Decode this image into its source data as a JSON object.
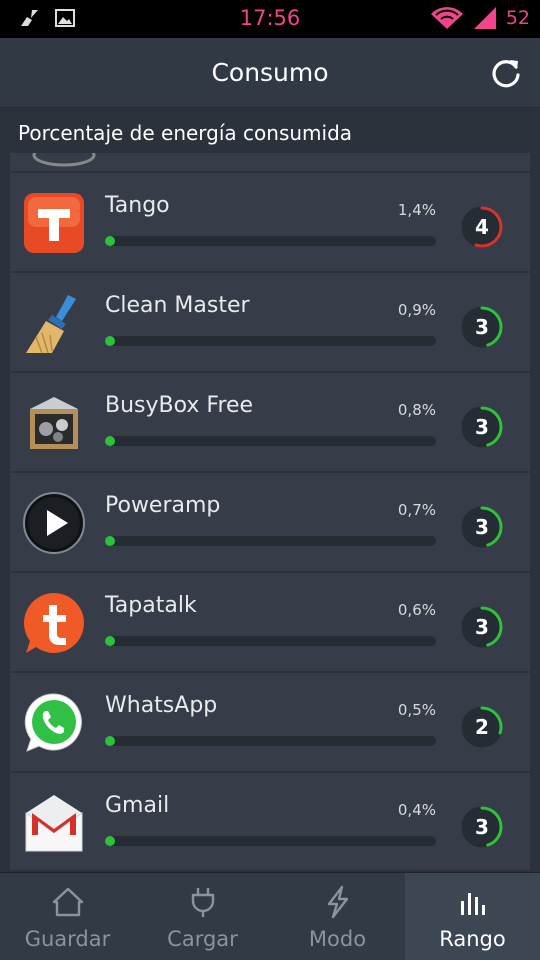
{
  "status_bar": {
    "time": "17:56",
    "battery": "52",
    "left_icons": [
      "broom-icon",
      "image-icon"
    ],
    "right_icons": [
      "wifi-icon",
      "signal-icon"
    ]
  },
  "header": {
    "title": "Consumo",
    "refresh_icon": "refresh-icon"
  },
  "section": {
    "title": "Porcentaje de energía consumida"
  },
  "apps": [
    {
      "name": "Tango",
      "percent": "1,4%",
      "rank": "4",
      "bar_fraction": 0.03,
      "rank_fraction": 0.55,
      "rank_color": "#d9342b",
      "icon": "tango-icon"
    },
    {
      "name": "Clean Master",
      "percent": "0,9%",
      "rank": "3",
      "bar_fraction": 0.03,
      "rank_fraction": 0.45,
      "rank_color": "#2cc23a",
      "icon": "broom-icon"
    },
    {
      "name": "BusyBox Free",
      "percent": "0,8%",
      "rank": "3",
      "bar_fraction": 0.03,
      "rank_fraction": 0.45,
      "rank_color": "#2cc23a",
      "icon": "busybox-icon"
    },
    {
      "name": "Poweramp",
      "percent": "0,7%",
      "rank": "3",
      "bar_fraction": 0.03,
      "rank_fraction": 0.45,
      "rank_color": "#2cc23a",
      "icon": "play-icon"
    },
    {
      "name": "Tapatalk",
      "percent": "0,6%",
      "rank": "3",
      "bar_fraction": 0.03,
      "rank_fraction": 0.45,
      "rank_color": "#2cc23a",
      "icon": "tapatalk-icon"
    },
    {
      "name": "WhatsApp",
      "percent": "0,5%",
      "rank": "2",
      "bar_fraction": 0.03,
      "rank_fraction": 0.3,
      "rank_color": "#2cc23a",
      "icon": "whatsapp-icon"
    },
    {
      "name": "Gmail",
      "percent": "0,4%",
      "rank": "3",
      "bar_fraction": 0.03,
      "rank_fraction": 0.45,
      "rank_color": "#2cc23a",
      "icon": "gmail-icon"
    }
  ],
  "nav": [
    {
      "label": "Guardar",
      "icon": "home-icon",
      "active": false
    },
    {
      "label": "Cargar",
      "icon": "plug-icon",
      "active": false
    },
    {
      "label": "Modo",
      "icon": "lightning-icon",
      "active": false
    },
    {
      "label": "Rango",
      "icon": "bar-chart-icon",
      "active": true
    }
  ],
  "colors": {
    "accent_pink": "#f0458a",
    "progress_green": "#2cc23a",
    "rank_red": "#d9342b",
    "background": "#2b323c",
    "row_background": "#363d48"
  }
}
